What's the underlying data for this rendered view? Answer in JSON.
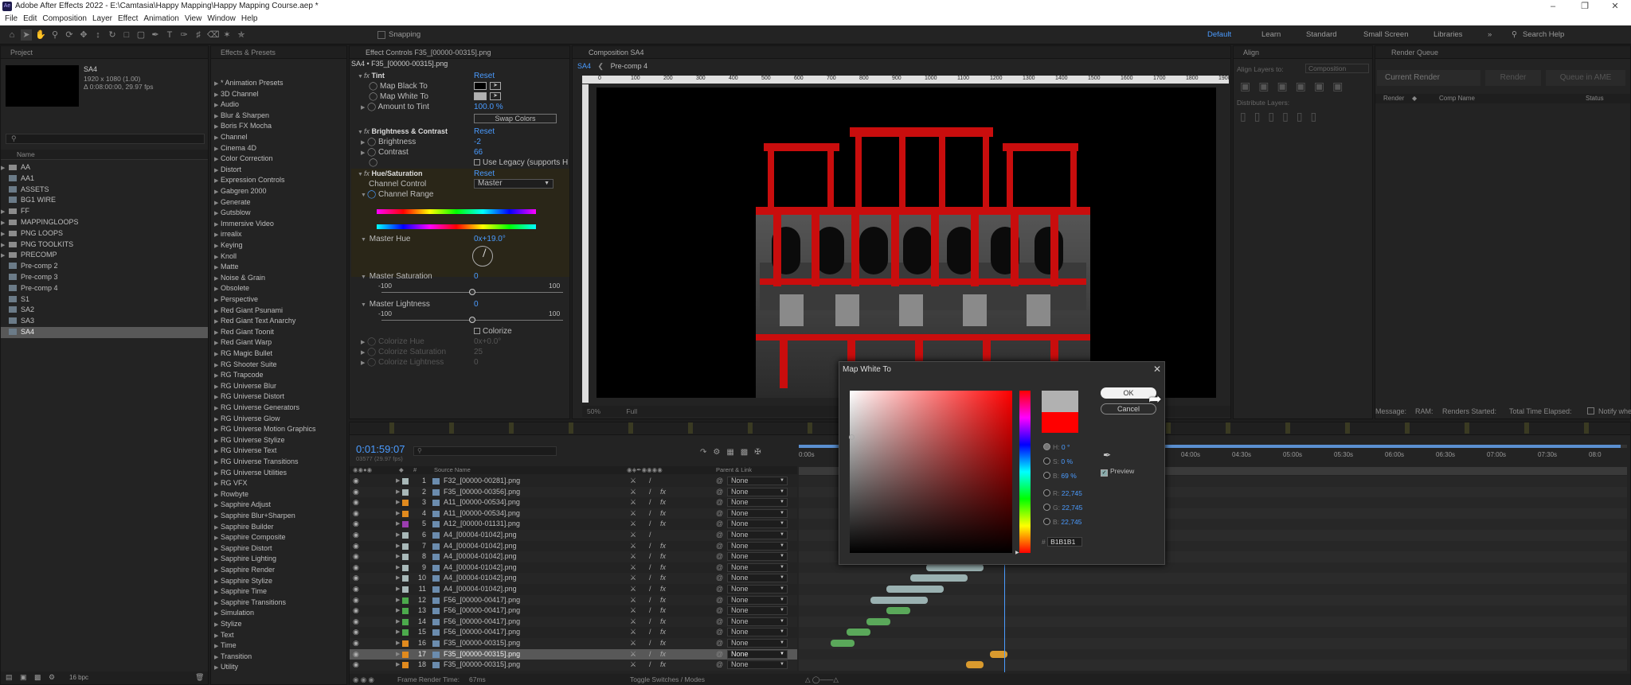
{
  "app": {
    "title": "Adobe After Effects 2022 - E:\\Camtasia\\Happy Mapping\\Happy Mapping Course.aep *",
    "icon_text": "Ae"
  },
  "menu": [
    "File",
    "Edit",
    "Composition",
    "Layer",
    "Effect",
    "Animation",
    "View",
    "Window",
    "Help"
  ],
  "toolbar": {
    "snapping": "Snapping",
    "workspaces": [
      "Default",
      "Learn",
      "Standard",
      "Small Screen",
      "Libraries"
    ],
    "search_placeholder": "Search Help"
  },
  "project": {
    "tab": "Project",
    "comp_name": "SA4",
    "comp_info1": "1920 x 1080 (1.00)",
    "comp_info2": "Δ 0:08:00:00, 29.97 fps",
    "name_header": "Name",
    "items": [
      {
        "label": "AA",
        "type": "folder"
      },
      {
        "label": "AA1",
        "type": "comp"
      },
      {
        "label": "ASSETS",
        "type": "comp"
      },
      {
        "label": "BG1 WIRE",
        "type": "comp"
      },
      {
        "label": "FF",
        "type": "folder"
      },
      {
        "label": "MAPPINGLOOPS",
        "type": "folder"
      },
      {
        "label": "PNG LOOPS",
        "type": "folder"
      },
      {
        "label": "PNG TOOLKITS",
        "type": "folder"
      },
      {
        "label": "PRECOMP",
        "type": "folder"
      },
      {
        "label": "Pre-comp 2",
        "type": "comp"
      },
      {
        "label": "Pre-comp 3",
        "type": "comp"
      },
      {
        "label": "Pre-comp 4",
        "type": "comp"
      },
      {
        "label": "S1",
        "type": "comp"
      },
      {
        "label": "SA2",
        "type": "comp"
      },
      {
        "label": "SA3",
        "type": "comp"
      },
      {
        "label": "SA4",
        "type": "comp"
      }
    ],
    "bpc": "16 bpc"
  },
  "effects": {
    "tab": "Effects & Presets",
    "items": [
      "* Animation Presets",
      "3D Channel",
      "Audio",
      "Blur & Sharpen",
      "Boris FX Mocha",
      "Channel",
      "Cinema 4D",
      "Color Correction",
      "Distort",
      "Expression Controls",
      "Gabgren 2000",
      "Generate",
      "Gutsblow",
      "Immersive Video",
      "irrealix",
      "Keying",
      "Knoll",
      "Matte",
      "Noise & Grain",
      "Obsolete",
      "Perspective",
      "Red Giant Psunami",
      "Red Giant Text Anarchy",
      "Red Giant Toonit",
      "Red Giant Warp",
      "RG Magic Bullet",
      "RG Shooter Suite",
      "RG Trapcode",
      "RG Universe Blur",
      "RG Universe Distort",
      "RG Universe Generators",
      "RG Universe Glow",
      "RG Universe Motion Graphics",
      "RG Universe Stylize",
      "RG Universe Text",
      "RG Universe Transitions",
      "RG Universe Utilities",
      "RG VFX",
      "Rowbyte",
      "Sapphire Adjust",
      "Sapphire Blur+Sharpen",
      "Sapphire Builder",
      "Sapphire Composite",
      "Sapphire Distort",
      "Sapphire Lighting",
      "Sapphire Render",
      "Sapphire Stylize",
      "Sapphire Time",
      "Sapphire Transitions",
      "Simulation",
      "Stylize",
      "Text",
      "Time",
      "Transition",
      "Utility"
    ]
  },
  "effect_controls": {
    "tab": "Effect Controls F35_[00000-00315].png",
    "layer": "SA4 • F35_[00000-00315].png",
    "reset": "Reset",
    "tint": {
      "name": "Tint",
      "map_black": "Map Black To",
      "map_white": "Map White To",
      "amount_label": "Amount to Tint",
      "amount_value": "100.0 %",
      "swap": "Swap Colors"
    },
    "bc": {
      "name": "Brightness & Contrast",
      "brightness_label": "Brightness",
      "brightness_value": "-2",
      "contrast_label": "Contrast",
      "contrast_value": "66",
      "legacy": "Use Legacy (supports H"
    },
    "hs": {
      "name": "Hue/Saturation",
      "channel_control_label": "Channel Control",
      "channel_control_value": "Master",
      "channel_range": "Channel Range",
      "master_hue": "Master Hue",
      "master_hue_value": "0x+19.0°",
      "master_sat": "Master Saturation",
      "master_sat_value": "0",
      "master_light": "Master Lightness",
      "master_light_value": "0",
      "min": "-100",
      "max": "100",
      "colorize": "Colorize",
      "colorize_hue": "Colorize Hue",
      "colorize_hue_value": "0x+0.0°",
      "colorize_sat": "Colorize Saturation",
      "colorize_sat_value": "25",
      "colorize_light": "Colorize Lightness",
      "colorize_light_value": "0"
    }
  },
  "composition": {
    "tab": "Composition SA4",
    "crumb1": "SA4",
    "crumb2": "Pre-comp 4",
    "ruler": [
      "0",
      "100",
      "200",
      "300",
      "400",
      "500",
      "600",
      "700",
      "800",
      "900",
      "1000",
      "1100",
      "1200",
      "1300",
      "1400",
      "1500",
      "1600",
      "1700",
      "1800",
      "1900"
    ],
    "zoom": "50%",
    "quality": "Full"
  },
  "align": {
    "tab": "Align",
    "align_to": "Align Layers to:",
    "align_to_value": "Composition",
    "distribute": "Distribute Layers:"
  },
  "render": {
    "tab": "Render Queue",
    "current": "Current Render",
    "render_btn": "Render",
    "queue_btn": "Queue in AME",
    "col_render": "Render",
    "col_comp": "Comp Name",
    "col_status": "Status",
    "footer": "Message:",
    "ram": "RAM:",
    "started": "Renders Started:",
    "elapsed": "Total Time Elapsed:",
    "notify": "Notify when"
  },
  "timeline": {
    "time": "0:01:59:07",
    "fps": "03577 (29.97 fps)",
    "source_header": "Source Name",
    "parent_header": "Parent & Link",
    "render_time_label": "Frame Render Time:",
    "render_time": "67ms",
    "toggle": "Toggle Switches / Modes",
    "ticks": [
      "0:00s",
      "04:00s",
      "04:30s",
      "05:00s",
      "05:30s",
      "06:00s",
      "06:30s",
      "07:00s",
      "07:30s",
      "08:0"
    ],
    "layers": [
      {
        "num": "1",
        "name": "F32_[00000-00281].png",
        "color": "#a8b8b8",
        "fx": false,
        "parent": "None"
      },
      {
        "num": "2",
        "name": "F35_[00000-00356].png",
        "color": "#a8b8b8",
        "fx": true,
        "parent": "None"
      },
      {
        "num": "3",
        "name": "A11_[00000-00534].png",
        "color": "#e08a1e",
        "fx": true,
        "parent": "None"
      },
      {
        "num": "4",
        "name": "A11_[00000-00534].png",
        "color": "#e08a1e",
        "fx": true,
        "parent": "None"
      },
      {
        "num": "5",
        "name": "A12_[00000-01131].png",
        "color": "#9b3db0",
        "fx": true,
        "parent": "None"
      },
      {
        "num": "6",
        "name": "A4_[00004-01042].png",
        "color": "#a8b8b8",
        "fx": false,
        "parent": "None"
      },
      {
        "num": "7",
        "name": "A4_[00004-01042].png",
        "color": "#a8b8b8",
        "fx": true,
        "parent": "None"
      },
      {
        "num": "8",
        "name": "A4_[00004-01042].png",
        "color": "#a8b8b8",
        "fx": true,
        "parent": "None"
      },
      {
        "num": "9",
        "name": "A4_[00004-01042].png",
        "color": "#a8b8b8",
        "fx": true,
        "parent": "None"
      },
      {
        "num": "10",
        "name": "A4_[00004-01042].png",
        "color": "#a8b8b8",
        "fx": true,
        "parent": "None"
      },
      {
        "num": "11",
        "name": "A4_[00004-01042].png",
        "color": "#a8b8b8",
        "fx": true,
        "parent": "None"
      },
      {
        "num": "12",
        "name": "F56_[00000-00417].png",
        "color": "#4caa4c",
        "fx": true,
        "parent": "None"
      },
      {
        "num": "13",
        "name": "F56_[00000-00417].png",
        "color": "#4caa4c",
        "fx": true,
        "parent": "None"
      },
      {
        "num": "14",
        "name": "F56_[00000-00417].png",
        "color": "#4caa4c",
        "fx": true,
        "parent": "None"
      },
      {
        "num": "15",
        "name": "F56_[00000-00417].png",
        "color": "#4caa4c",
        "fx": true,
        "parent": "None"
      },
      {
        "num": "16",
        "name": "F35_[00000-00315].png",
        "color": "#e08a1e",
        "fx": true,
        "parent": "None"
      },
      {
        "num": "17",
        "name": "F35_[00000-00315].png",
        "color": "#e08a1e",
        "fx": true,
        "parent": "None"
      },
      {
        "num": "18",
        "name": "F35_[00000-00315].png",
        "color": "#e08a1e",
        "fx": true,
        "parent": "None"
      }
    ]
  },
  "dialog": {
    "title": "Map White To",
    "ok": "OK",
    "cancel": "Cancel",
    "h_label": "H:",
    "h_value": "0 °",
    "s_label": "S:",
    "s_value": "0 %",
    "b_label": "B:",
    "b_value": "69 %",
    "r_label": "R:",
    "r_value": "22,745",
    "g_label": "G:",
    "g_value": "22,745",
    "bb_label": "B:",
    "bb_value": "22,745",
    "hex_label": "#",
    "hex_value": "B1B1B1",
    "preview": "Preview",
    "new_color": "#b1b1b1",
    "old_color": "#ff0000"
  }
}
